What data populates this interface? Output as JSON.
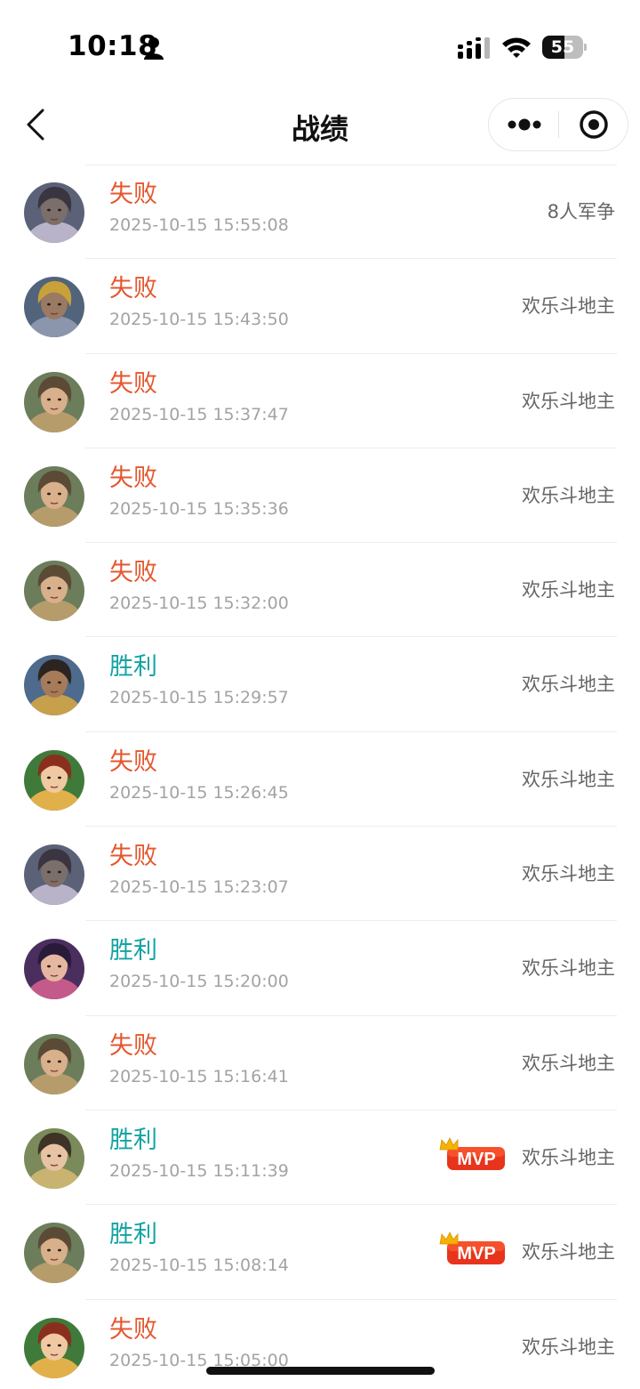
{
  "status_bar": {
    "time": "10:18",
    "battery": "55"
  },
  "nav": {
    "title": "战绩"
  },
  "records": [
    {
      "result": "失败",
      "outcome": "lose",
      "time": "2025-10-15 15:55:08",
      "mode": "8人军争",
      "mvp": false,
      "avatar": {
        "skin": "#7a6f6a",
        "hair": "#3a3540",
        "bg": "#5b6176",
        "accent": "#b8b3c9"
      }
    },
    {
      "result": "失败",
      "outcome": "lose",
      "time": "2025-10-15 15:43:50",
      "mode": "欢乐斗地主",
      "mvp": false,
      "avatar": {
        "skin": "#9a7a62",
        "hair": "#c9a13a",
        "bg": "#52647c",
        "accent": "#8b96ad"
      }
    },
    {
      "result": "失败",
      "outcome": "lose",
      "time": "2025-10-15 15:37:47",
      "mode": "欢乐斗地主",
      "mvp": false,
      "avatar": {
        "skin": "#d9b08c",
        "hair": "#5b4a36",
        "bg": "#6b7d5a",
        "accent": "#b69c6b"
      }
    },
    {
      "result": "失败",
      "outcome": "lose",
      "time": "2025-10-15 15:35:36",
      "mode": "欢乐斗地主",
      "mvp": false,
      "avatar": {
        "skin": "#d9b08c",
        "hair": "#5b4a36",
        "bg": "#6b7d5a",
        "accent": "#b69c6b"
      }
    },
    {
      "result": "失败",
      "outcome": "lose",
      "time": "2025-10-15 15:32:00",
      "mode": "欢乐斗地主",
      "mvp": false,
      "avatar": {
        "skin": "#d9b08c",
        "hair": "#5b4a36",
        "bg": "#6b7d5a",
        "accent": "#b69c6b"
      }
    },
    {
      "result": "胜利",
      "outcome": "win",
      "time": "2025-10-15 15:29:57",
      "mode": "欢乐斗地主",
      "mvp": false,
      "avatar": {
        "skin": "#a57b5a",
        "hair": "#2b2420",
        "bg": "#4e6a8c",
        "accent": "#c6a04b"
      }
    },
    {
      "result": "失败",
      "outcome": "lose",
      "time": "2025-10-15 15:26:45",
      "mode": "欢乐斗地主",
      "mvp": false,
      "avatar": {
        "skin": "#f0c8a2",
        "hair": "#8a2f1e",
        "bg": "#3f7a3a",
        "accent": "#e2b04a"
      }
    },
    {
      "result": "失败",
      "outcome": "lose",
      "time": "2025-10-15 15:23:07",
      "mode": "欢乐斗地主",
      "mvp": false,
      "avatar": {
        "skin": "#7a6f6a",
        "hair": "#3a3540",
        "bg": "#5b6176",
        "accent": "#b8b3c9"
      }
    },
    {
      "result": "胜利",
      "outcome": "win",
      "time": "2025-10-15 15:20:00",
      "mode": "欢乐斗地主",
      "mvp": false,
      "avatar": {
        "skin": "#e6b7a0",
        "hair": "#2a1a3a",
        "bg": "#4a2f5e",
        "accent": "#c45a8a"
      }
    },
    {
      "result": "失败",
      "outcome": "lose",
      "time": "2025-10-15 15:16:41",
      "mode": "欢乐斗地主",
      "mvp": false,
      "avatar": {
        "skin": "#d9b08c",
        "hair": "#5b4a36",
        "bg": "#6b7d5a",
        "accent": "#b69c6b"
      }
    },
    {
      "result": "胜利",
      "outcome": "win",
      "time": "2025-10-15 15:11:39",
      "mode": "欢乐斗地主",
      "mvp": true,
      "avatar": {
        "skin": "#e7c2a3",
        "hair": "#3d3326",
        "bg": "#7a8a5a",
        "accent": "#c9b370"
      }
    },
    {
      "result": "胜利",
      "outcome": "win",
      "time": "2025-10-15 15:08:14",
      "mode": "欢乐斗地主",
      "mvp": true,
      "avatar": {
        "skin": "#d9b08c",
        "hair": "#5b4a36",
        "bg": "#6b7d5a",
        "accent": "#b69c6b"
      }
    },
    {
      "result": "失败",
      "outcome": "lose",
      "time": "2025-10-15 15:05:00",
      "mode": "欢乐斗地主",
      "mvp": false,
      "avatar": {
        "skin": "#f0c8a2",
        "hair": "#8a2f1e",
        "bg": "#3f7a3a",
        "accent": "#e2b04a"
      }
    }
  ],
  "badges": {
    "mvp": "MVP"
  },
  "colors": {
    "lose": "#e4572e",
    "win": "#14a3a3",
    "mvp_badge": "#e8341c",
    "crown": "#f4b400"
  }
}
